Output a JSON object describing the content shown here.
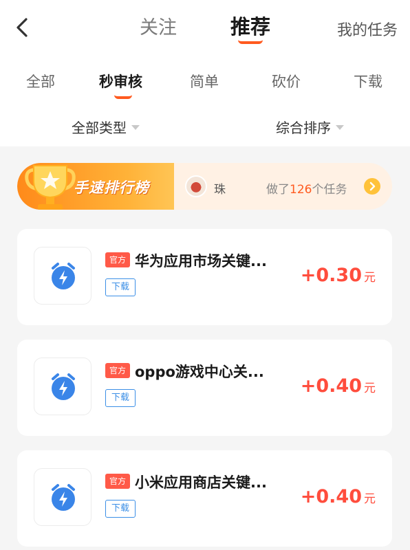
{
  "header": {
    "tabs": [
      {
        "label": "关注",
        "active": false
      },
      {
        "label": "推荐",
        "active": true
      }
    ],
    "my_tasks": "我的任务"
  },
  "sub_tabs": [
    {
      "label": "全部",
      "active": false
    },
    {
      "label": "秒审核",
      "active": true
    },
    {
      "label": "简单",
      "active": false
    },
    {
      "label": "砍价",
      "active": false
    },
    {
      "label": "下载",
      "active": false
    }
  ],
  "filters": {
    "type": "全部类型",
    "sort": "综合排序"
  },
  "rank_banner": {
    "title": "手速排行榜",
    "user_name": "珠",
    "count_prefix": "做了",
    "count_value": "126",
    "count_suffix": "个任务"
  },
  "tasks": [
    {
      "badge": "官方",
      "title": "华为应用市场关键...",
      "tag": "下载",
      "amount": "+0.30",
      "unit": "元"
    },
    {
      "badge": "官方",
      "title": "oppo游戏中心关...",
      "tag": "下载",
      "amount": "+0.40",
      "unit": "元"
    },
    {
      "badge": "官方",
      "title": "小米应用商店关键...",
      "tag": "下载",
      "amount": "+0.40",
      "unit": "元"
    }
  ],
  "colors": {
    "accent": "#ff5a1f",
    "reward": "#ff4d3d",
    "tag_blue": "#3a8ee6",
    "icon_blue": "#3a85e8"
  },
  "icons": {
    "back": "chevron-left-icon",
    "task": "alarm-clock-icon",
    "trophy": "trophy-icon",
    "rank_arrow": "chevron-right-icon"
  }
}
